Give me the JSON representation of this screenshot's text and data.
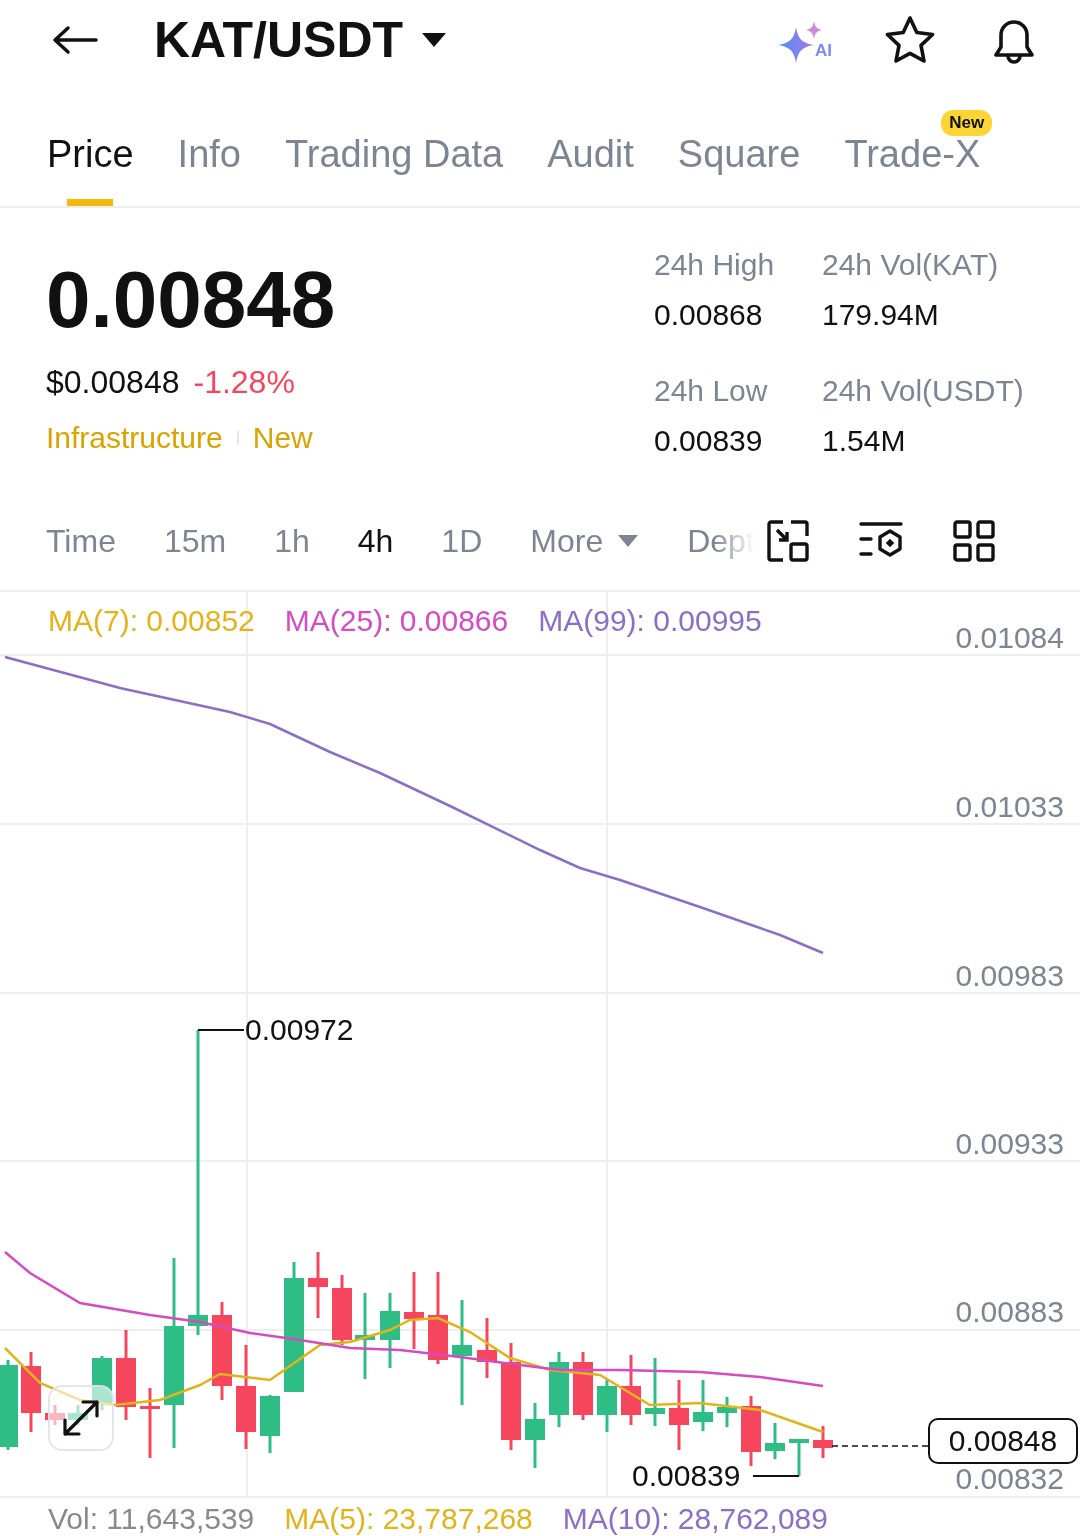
{
  "header": {
    "title": "KAT/USDT",
    "ai_label": "AI"
  },
  "tabs": [
    {
      "label": "Price",
      "selected": true
    },
    {
      "label": "Info",
      "selected": false
    },
    {
      "label": "Trading Data",
      "selected": false
    },
    {
      "label": "Audit",
      "selected": false
    },
    {
      "label": "Square",
      "selected": false
    },
    {
      "label": "Trade-X",
      "selected": false,
      "badge": "New"
    }
  ],
  "price": {
    "last": "0.00848",
    "fiat": "$0.00848",
    "change": "-1.28%",
    "tags": [
      "Infrastructure",
      "New"
    ]
  },
  "stats": [
    {
      "label": "24h High",
      "value": "0.00868"
    },
    {
      "label": "24h Vol(KAT)",
      "value": "179.94M"
    },
    {
      "label": "24h Low",
      "value": "0.00839"
    },
    {
      "label": "24h Vol(USDT)",
      "value": "1.54M"
    }
  ],
  "intervals": [
    {
      "label": "Time",
      "kind": "text",
      "selected": false
    },
    {
      "label": "15m",
      "kind": "text",
      "selected": false
    },
    {
      "label": "1h",
      "kind": "text",
      "selected": false
    },
    {
      "label": "4h",
      "kind": "text",
      "selected": true
    },
    {
      "label": "1D",
      "kind": "text",
      "selected": false
    },
    {
      "label": "More",
      "kind": "dropdown",
      "selected": false
    },
    {
      "label": "Dept",
      "kind": "faded",
      "selected": false
    }
  ],
  "chart": {
    "indicators": [
      {
        "label": "MA(7): 0.00852",
        "color": "#e2b31a"
      },
      {
        "label": "MA(25): 0.00866",
        "color": "#d64bbf"
      },
      {
        "label": "MA(99): 0.00995",
        "color": "#8b6fc4"
      }
    ],
    "price_axis": [
      "0.01084",
      "0.01033",
      "0.00983",
      "0.00933",
      "0.00883",
      "0.00832"
    ],
    "high_marker": "0.00972",
    "low_marker": "0.00839",
    "current_price": "0.00848"
  },
  "volume": [
    {
      "label": "Vol: 11,643,539",
      "color": "#8a8a8a"
    },
    {
      "label": "MA(5): 23,787,268",
      "color": "#e2b31a"
    },
    {
      "label": "MA(10): 28,762,089",
      "color": "#8b6fc4"
    }
  ]
}
